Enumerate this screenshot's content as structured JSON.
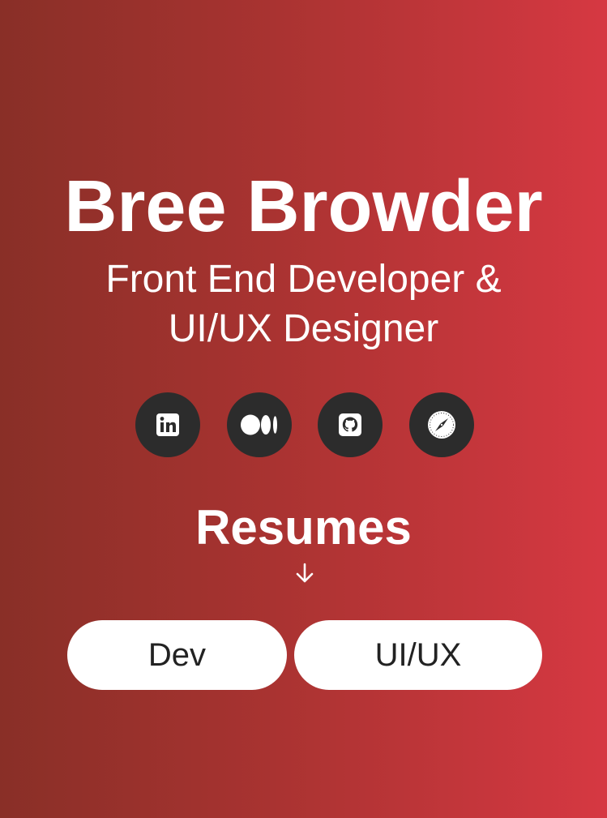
{
  "profile": {
    "name": "Bree Browder",
    "subtitle_line1": "Front End Developer &",
    "subtitle_line2": "UI/UX Designer"
  },
  "socials": [
    {
      "icon": "linkedin-icon"
    },
    {
      "icon": "medium-icon"
    },
    {
      "icon": "github-icon"
    },
    {
      "icon": "safari-compass-icon"
    }
  ],
  "resumes": {
    "title": "Resumes",
    "arrow_icon": "arrow-down-icon",
    "buttons": [
      {
        "label": "Dev"
      },
      {
        "label": "UI/UX"
      }
    ]
  },
  "colors": {
    "gradient_start": "#892f27",
    "gradient_end": "#d63842",
    "icon_bg": "#2c2c2c",
    "button_bg": "#ffffff",
    "button_text": "#222222"
  }
}
